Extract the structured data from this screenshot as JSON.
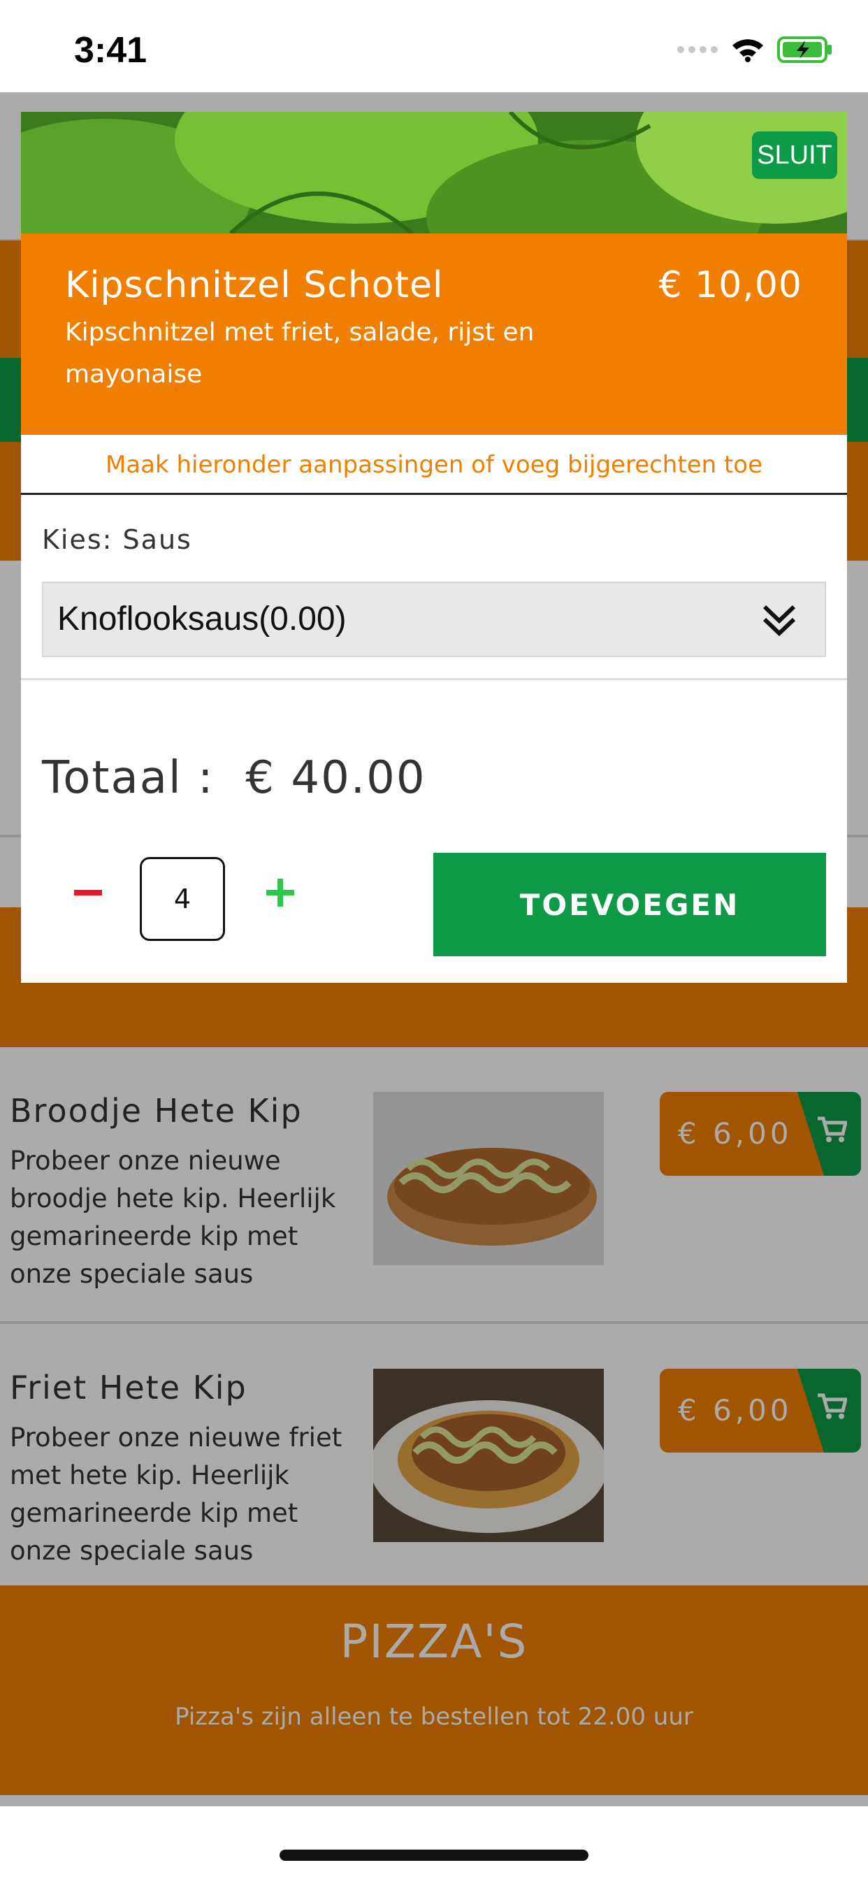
{
  "status_bar": {
    "time": "3:41"
  },
  "modal": {
    "close_label": "SLUIT",
    "item_title": "Kipschnitzel Schotel",
    "item_price": "€ 10,00",
    "item_description": "Kipschnitzel met friet, salade, rijst en mayonaise",
    "hint": "Maak hieronder aanpassingen of voeg bijgerechten toe",
    "option_label": "Kies: Saus",
    "option_selected": "Knoflooksaus(0.00)",
    "total_label": "Totaal :",
    "total_value": "€ 40.00",
    "quantity": "4",
    "add_label": "TOEVOEGEN"
  },
  "products": [
    {
      "name": "Broodje Hete Kip",
      "description": "Probeer onze nieuwe broodje hete kip. Heerlijk gemarineerde kip met onze speciale saus",
      "price": "€ 6,00"
    },
    {
      "name": "Friet Hete Kip",
      "description": "Probeer onze nieuwe friet met hete kip. Heerlijk gemarineerde kip met onze speciale saus",
      "price": "€ 6,00"
    }
  ],
  "section": {
    "title": "PIZZA'S",
    "subtitle": "Pizza's zijn alleen te bestellen tot 22.00 uur"
  },
  "colors": {
    "brand_orange": "#f07f00",
    "brand_green": "#0d9a47",
    "minus_red": "#e8162b",
    "plus_green": "#2cc84a"
  },
  "icons": [
    "wifi-icon",
    "battery-icon",
    "signal-icon",
    "chevron-double-down-icon",
    "cart-icon",
    "minus-icon",
    "plus-icon"
  ]
}
